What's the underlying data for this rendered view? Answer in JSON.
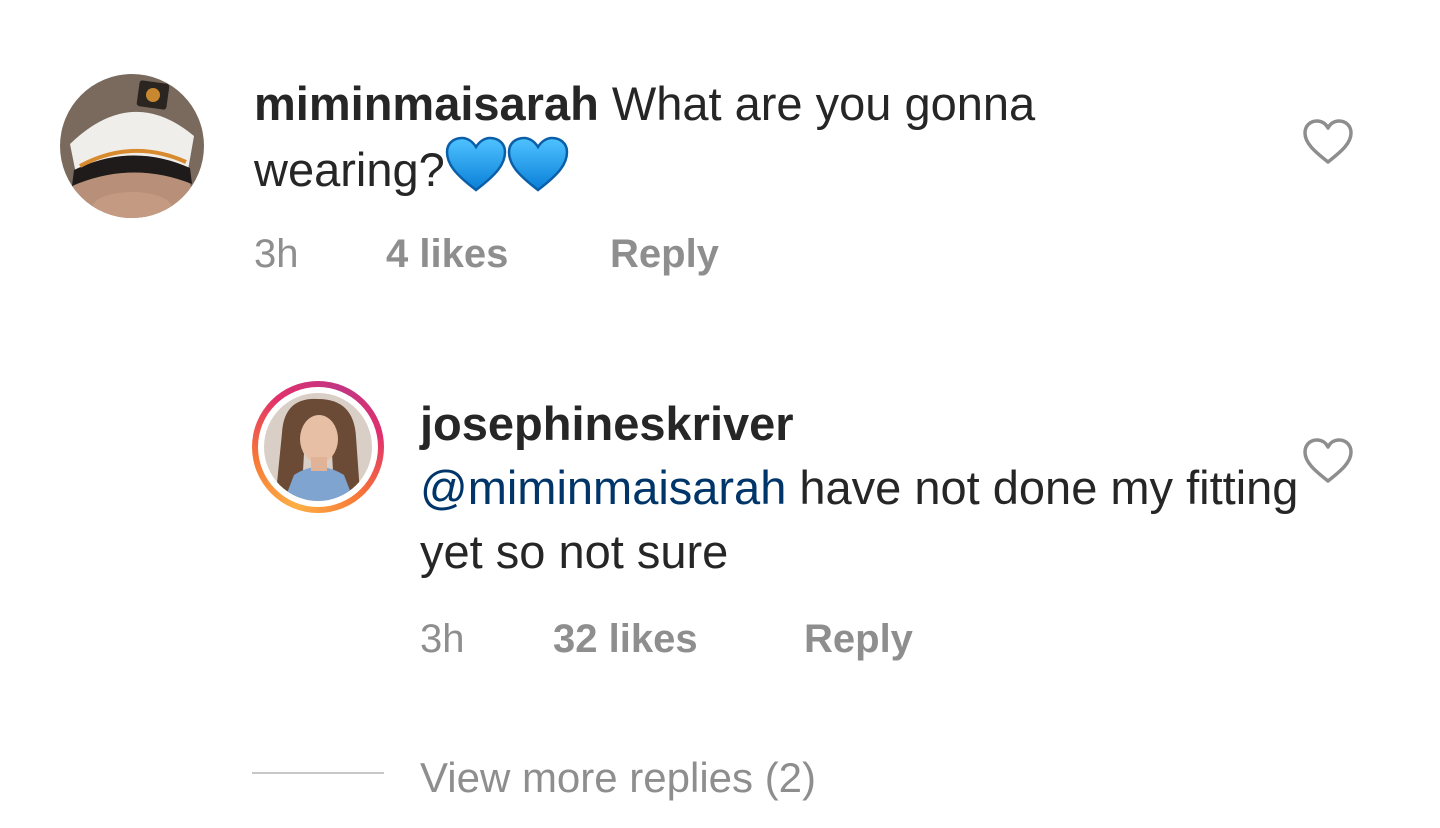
{
  "comments": [
    {
      "username": "miminmaisarah",
      "text": "What are you gonna wearing?",
      "emoji": [
        "blue-heart",
        "blue-heart"
      ],
      "time": "3h",
      "likes": "4 likes",
      "reply_label": "Reply"
    }
  ],
  "reply": {
    "username": "josephineskriver",
    "mention": "@miminmaisarah",
    "text": "have not done my fitting yet so not sure",
    "time": "3h",
    "likes": "32 likes",
    "reply_label": "Reply"
  },
  "view_more": {
    "label": "View more replies (2)"
  },
  "colors": {
    "text": "#262626",
    "meta": "#8e8e8e",
    "mention": "#003569",
    "heart_emoji": "#1da1f2"
  }
}
